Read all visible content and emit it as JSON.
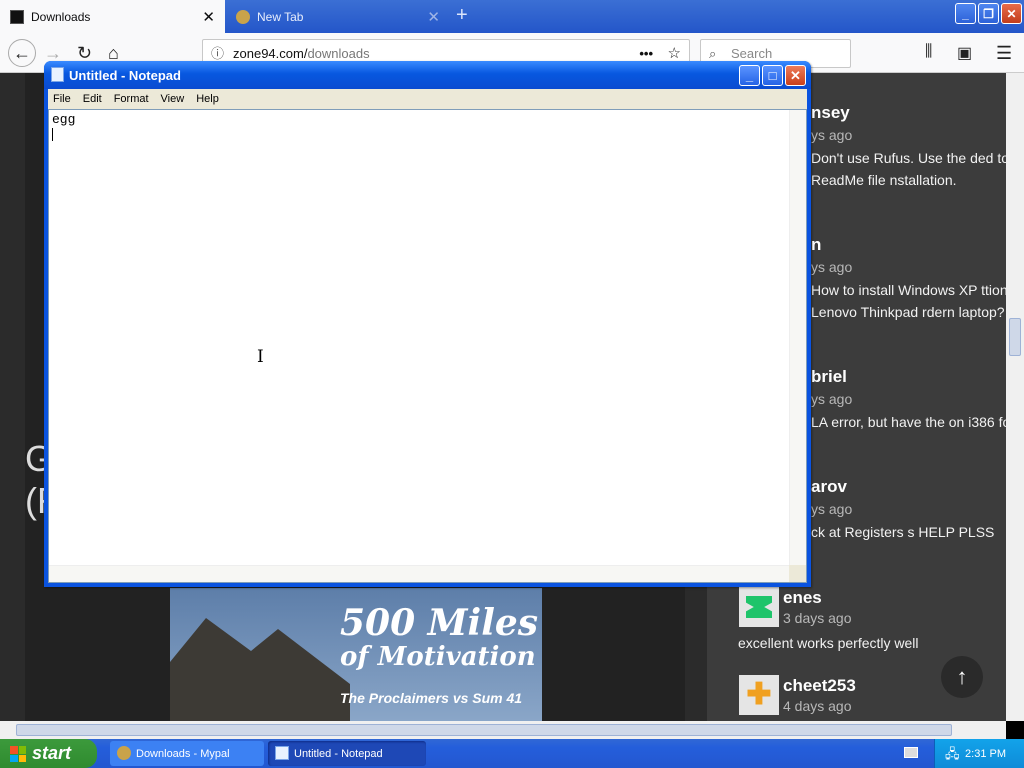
{
  "browser": {
    "tabs": [
      {
        "label": "Downloads",
        "active": true
      },
      {
        "label": "New Tab",
        "active": false
      }
    ],
    "url_host": "zone94.com/",
    "url_path": "downloads",
    "search_placeholder": "Search"
  },
  "page": {
    "heading_fragment_1": "G",
    "heading_fragment_2": "(F",
    "comments": [
      {
        "name": "nsey",
        "time": "ys ago",
        "text": "Don't use Rufus. Use the ded tool in the ReadMe file nstallation."
      },
      {
        "name": "n",
        "time": "ys ago",
        "text": "How to install Windows XP ttion on a Lenovo Thinkpad rdern laptop?"
      },
      {
        "name": "briel",
        "time": "ys ago",
        "text": "LA error, but have the on i386 folder..."
      },
      {
        "name": "arov",
        "time": "ys ago",
        "text": "ck at Registers s HELP PLSS"
      },
      {
        "name": "enes",
        "time": "3 days ago",
        "text": "excellent works perfectly well"
      },
      {
        "name": "cheet253",
        "time": "4 days ago",
        "text": ""
      }
    ],
    "poster": {
      "title_line1": "500 Miles",
      "title_line2": "of Motivation",
      "subtitle": "The Proclaimers vs Sum 41"
    }
  },
  "notepad": {
    "title": "Untitled - Notepad",
    "menu": [
      "File",
      "Edit",
      "Format",
      "View",
      "Help"
    ],
    "content": "egg"
  },
  "taskbar": {
    "start_label": "start",
    "tasks": [
      {
        "label": "Downloads - Mypal",
        "active": false
      },
      {
        "label": "Untitled - Notepad",
        "active": true
      }
    ],
    "clock": "2:31 PM"
  }
}
